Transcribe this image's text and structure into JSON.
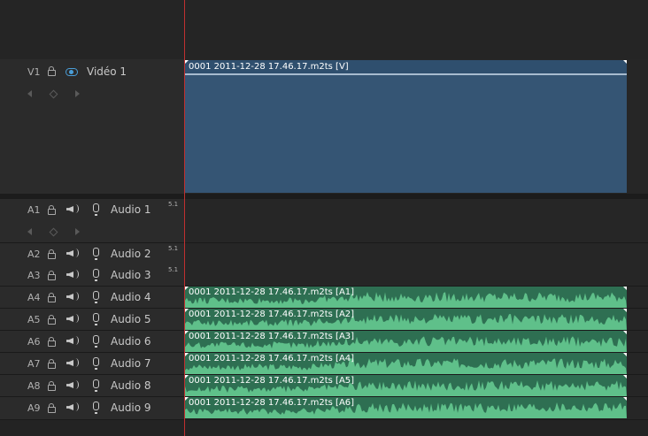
{
  "video_tracks": [
    {
      "id": "V1",
      "name": "Vidéo 1",
      "clip": "0001 2011-12-28 17.46.17.m2ts [V]"
    }
  ],
  "audio_tracks": [
    {
      "id": "A1",
      "name": "Audio 1",
      "channels": "5.1",
      "clip": ""
    },
    {
      "id": "A2",
      "name": "Audio 2",
      "channels": "5.1",
      "clip": ""
    },
    {
      "id": "A3",
      "name": "Audio 3",
      "channels": "5.1",
      "clip": ""
    },
    {
      "id": "A4",
      "name": "Audio 4",
      "channels": "",
      "clip": "0001 2011-12-28 17.46.17.m2ts [A1]"
    },
    {
      "id": "A5",
      "name": "Audio 5",
      "channels": "",
      "clip": "0001 2011-12-28 17.46.17.m2ts [A2]"
    },
    {
      "id": "A6",
      "name": "Audio 6",
      "channels": "",
      "clip": "0001 2011-12-28 17.46.17.m2ts [A3]"
    },
    {
      "id": "A7",
      "name": "Audio 7",
      "channels": "",
      "clip": "0001 2011-12-28 17.46.17.m2ts [A4]"
    },
    {
      "id": "A8",
      "name": "Audio 8",
      "channels": "",
      "clip": "0001 2011-12-28 17.46.17.m2ts [A5]"
    },
    {
      "id": "A9",
      "name": "Audio 9",
      "channels": "",
      "clip": "0001 2011-12-28 17.46.17.m2ts [A6]"
    }
  ],
  "icons": {
    "lock": "lock-icon",
    "eye": "eye-icon",
    "speaker": "speaker-icon",
    "mic": "microphone-icon",
    "prev_keyframe": "previous-keyframe-icon",
    "add_keyframe": "add-keyframe-icon",
    "next_keyframe": "next-keyframe-icon"
  },
  "colors": {
    "video_clip": "#355574",
    "audio_clip": "#2e6f52",
    "waveform": "#5fc08a",
    "playhead": "#c03030",
    "eye_accent": "#4a9ed8"
  }
}
